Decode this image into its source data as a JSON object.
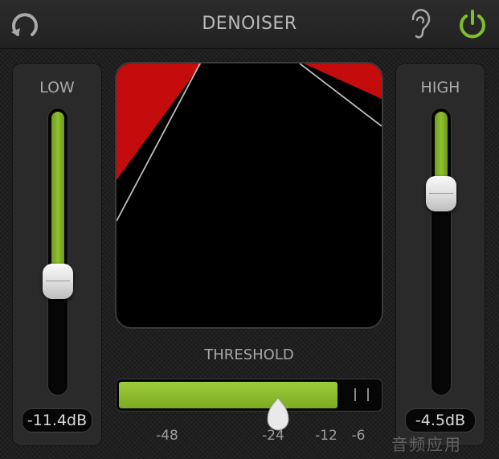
{
  "header": {
    "title": "DENOISER",
    "reset_icon": "reset-circular-arrow-icon",
    "listen_icon": "ear-icon",
    "power_icon": "power-icon"
  },
  "low": {
    "label": "LOW",
    "value_text": "-11.4dB",
    "level": 0.62
  },
  "high": {
    "label": "HIGH",
    "value_text": "-4.5dB",
    "level": 0.27
  },
  "threshold": {
    "label": "THRESHOLD",
    "level": 0.84,
    "handle_position": 0.61,
    "scale": [
      "-48",
      "-24",
      "-12",
      "-6"
    ]
  },
  "watermark": {
    "text": "音频应用"
  },
  "colors": {
    "accent_green": "#8fc030",
    "power_green": "#7fbf2a",
    "display_red": "#c40c0c"
  }
}
